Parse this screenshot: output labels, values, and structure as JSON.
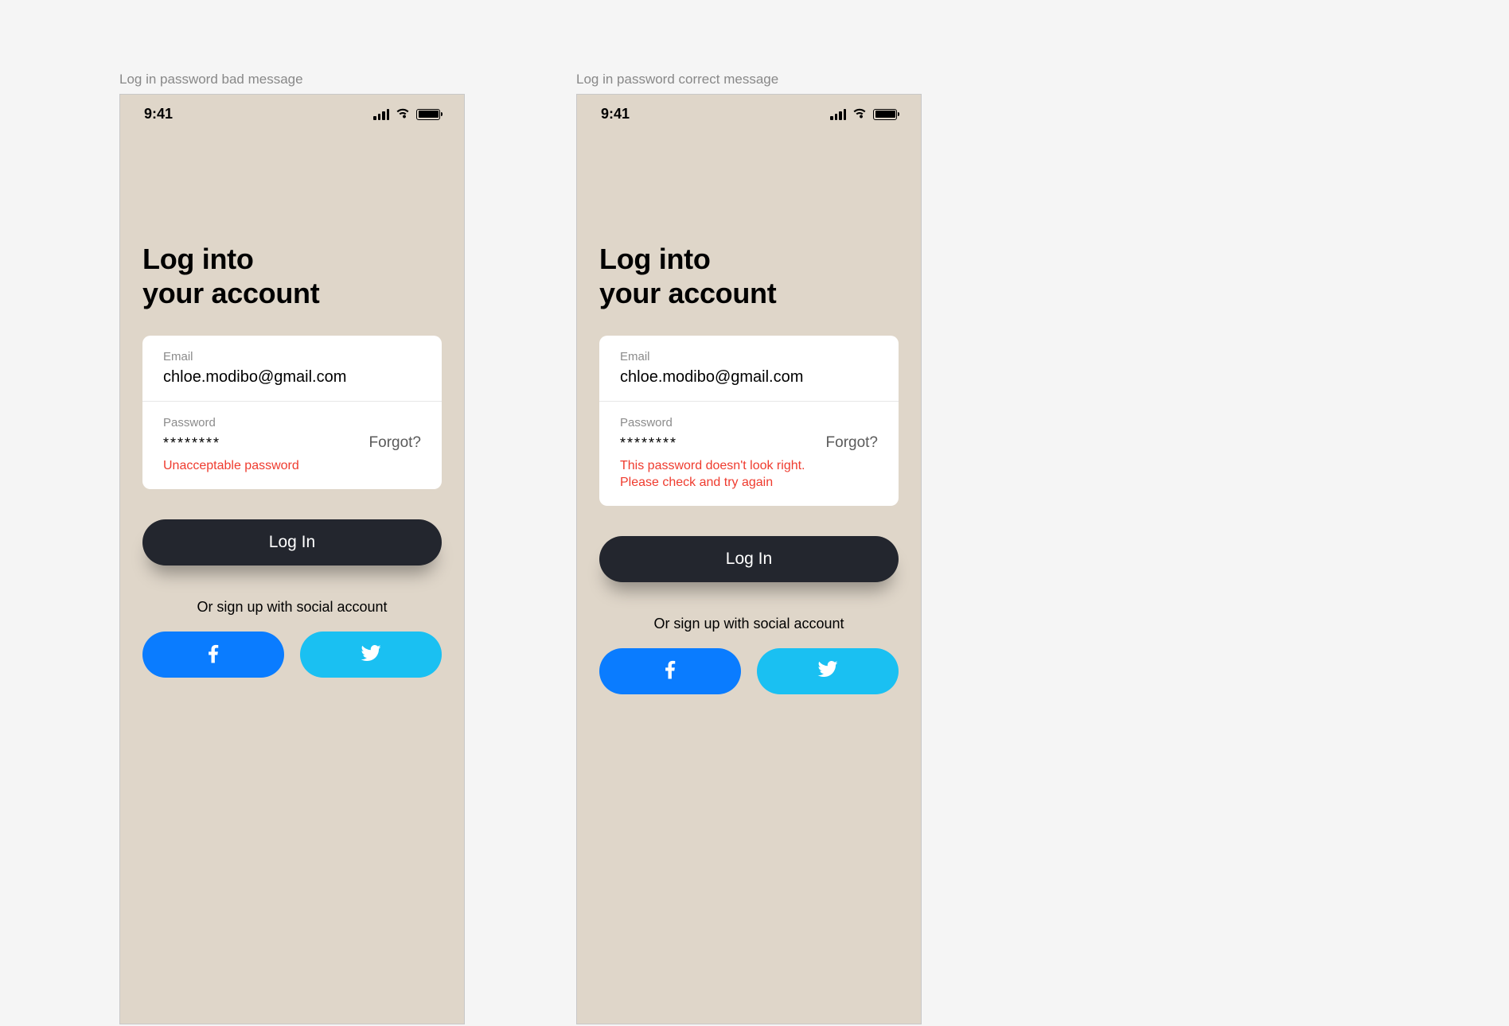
{
  "statusbar": {
    "time": "9:41"
  },
  "login": {
    "title_line1": "Log into",
    "title_line2": "your account",
    "email_label": "Email",
    "email_value": "chloe.modibo@gmail.com",
    "password_label": "Password",
    "password_value": "********",
    "forgot_label": "Forgot?",
    "button_label": "Log In",
    "social_prompt": "Or sign up with social account"
  },
  "frames": {
    "left": {
      "label": "Log in password bad message",
      "error": "Unacceptable password"
    },
    "right": {
      "label": "Log in password correct message",
      "error": "This password doesn't look right.\nPlease check and try again"
    }
  }
}
